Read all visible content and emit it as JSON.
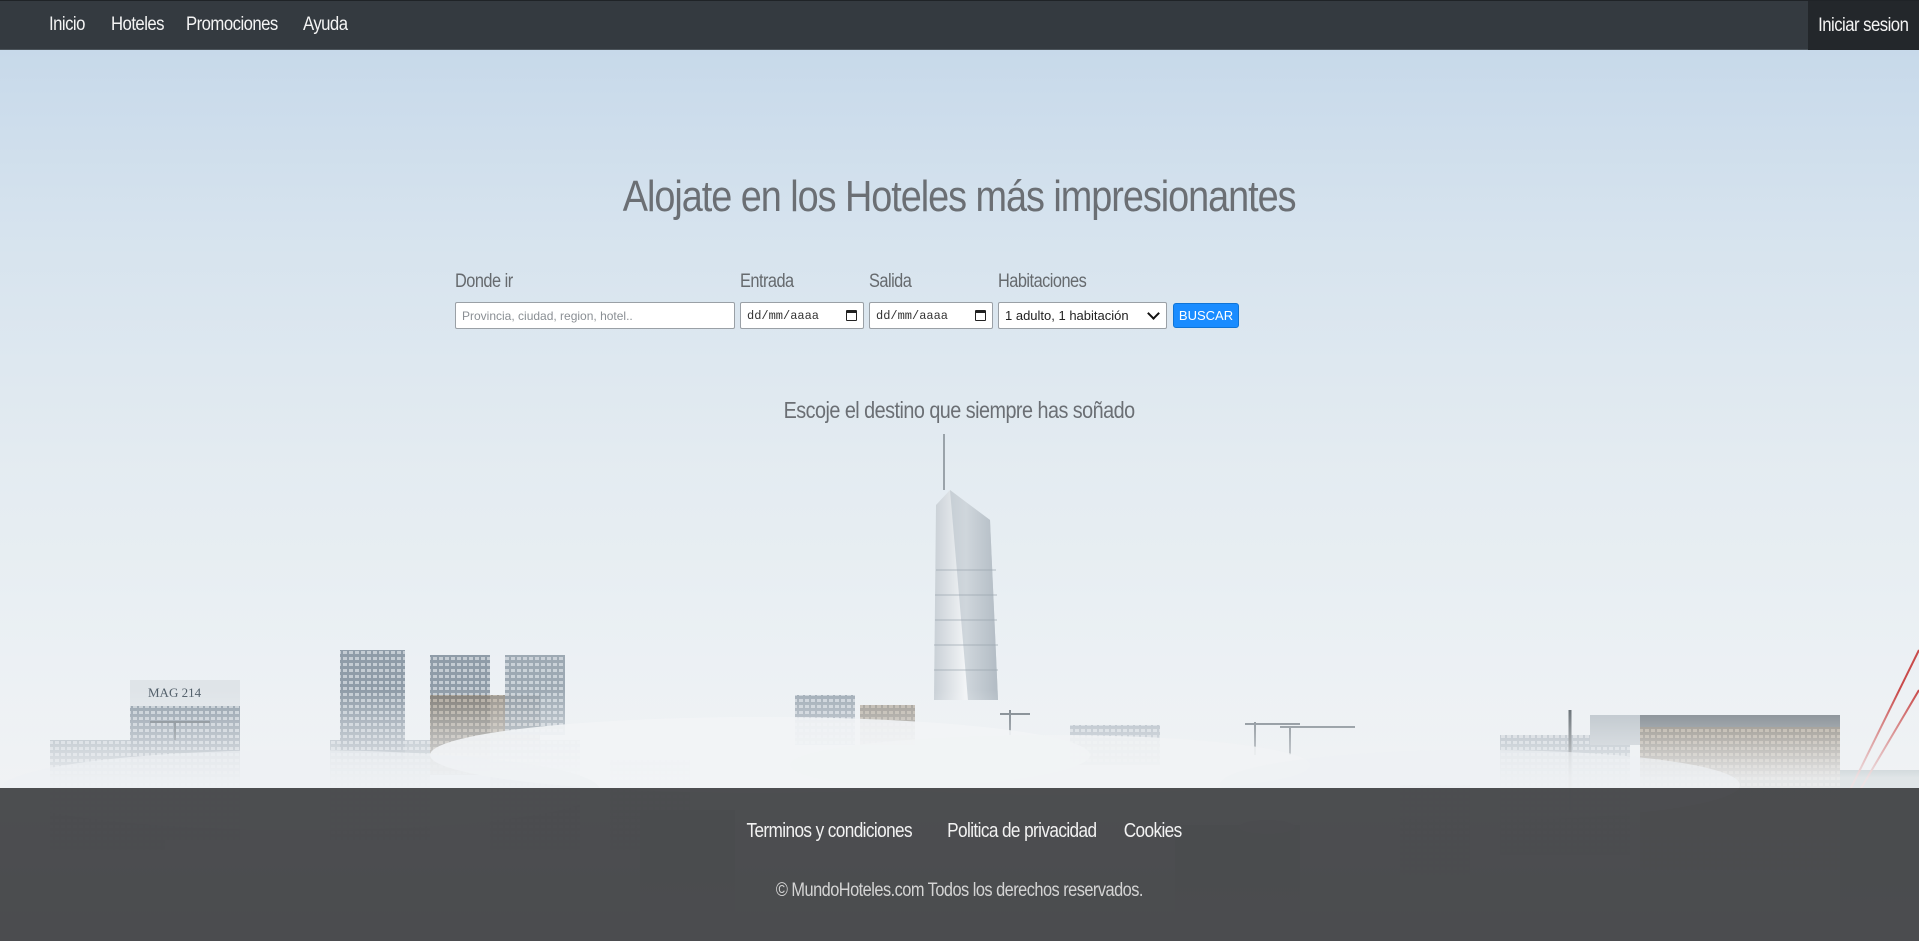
{
  "nav": {
    "items": [
      {
        "label": "Inicio"
      },
      {
        "label": "Hoteles"
      },
      {
        "label": "Promociones"
      },
      {
        "label": "Ayuda"
      }
    ],
    "login_label": "Iniciar sesion"
  },
  "hero": {
    "title": "Alojate en los Hoteles más impresionantes",
    "subtitle": "Escoje el destino que siempre has soñado",
    "building_sign": "MAG 214"
  },
  "search": {
    "where_label": "Donde ir",
    "where_placeholder": "Provincia, ciudad, region, hotel..",
    "checkin_label": "Entrada",
    "checkin_value": "dd/mm/aaaa",
    "checkout_label": "Salida",
    "checkout_value": "dd/mm/aaaa",
    "rooms_label": "Habitaciones",
    "rooms_value": "1 adulto, 1 habitación",
    "button_label": "BUSCAR"
  },
  "footer": {
    "links": [
      {
        "label": "Terminos y condiciones"
      },
      {
        "label": "Politica de privacidad"
      },
      {
        "label": "Cookies"
      }
    ],
    "copyright": "© MundoHoteles.com Todos los derechos reservados."
  },
  "colors": {
    "navbar": "#343a40",
    "login_button": "#23272b",
    "search_button": "#1a8cff",
    "footer": "#282a2c"
  }
}
